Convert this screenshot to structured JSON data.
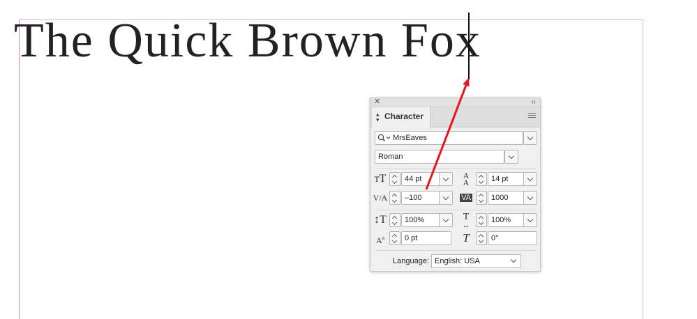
{
  "document": {
    "headline": "The Quick Brown Fox"
  },
  "annotation": {
    "arrow_color": "#e8141c"
  },
  "panel": {
    "title": "Character",
    "close_glyph": "✕",
    "collapse_glyph": "‹‹",
    "font_family": "MrsEaves",
    "font_style": "Roman",
    "font_size": "44 pt",
    "leading": "14 pt",
    "kerning": "–100",
    "tracking": "1000",
    "vertical_scale": "100%",
    "horizontal_scale": "100%",
    "baseline_shift": "0 pt",
    "skew": "0°",
    "language_label": "Language:",
    "language_value": "English: USA"
  },
  "icons": {
    "search": "search-icon",
    "font_size": "font-size-icon",
    "leading": "leading-icon",
    "kerning": "kerning-icon",
    "tracking": "tracking-icon",
    "vertical_scale": "vertical-scale-icon",
    "horizontal_scale": "horizontal-scale-icon",
    "baseline_shift": "baseline-shift-icon",
    "skew": "skew-icon"
  }
}
